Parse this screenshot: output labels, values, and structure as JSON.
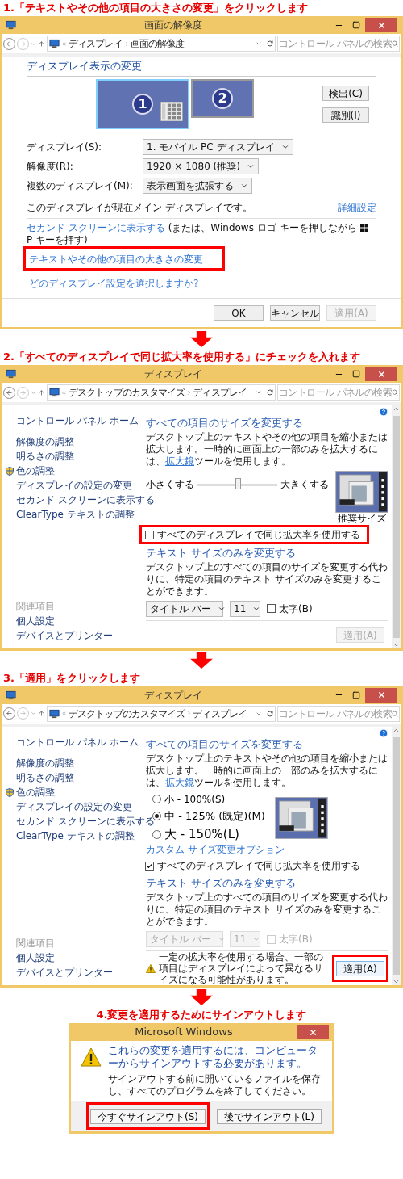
{
  "step1": {
    "heading": "1.「テキストやその他の項目の大きさの変更」をクリックします",
    "window": {
      "title": "画面の解像度",
      "breadcrumbs": [
        "ディスプレイ",
        "画面の解像度"
      ],
      "search": {
        "placeholder": "コントロール パネルの検索"
      },
      "section_title": "ディスプレイ表示の変更",
      "monitors": [
        {
          "label": "1",
          "selected": true
        },
        {
          "label": "2",
          "selected": false
        }
      ],
      "side_buttons": [
        "検出(C)",
        "識別(I)"
      ],
      "fields": [
        {
          "label": "ディスプレイ(S):",
          "value": "1. モバイル PC ディスプレイ"
        },
        {
          "label": "解像度(R):",
          "value": "1920 × 1080 (推奨)"
        },
        {
          "label": "複数のディスプレイ(M):",
          "value": "表示画面を拡張する"
        }
      ],
      "main_note": "このディスプレイが現在メイン ディスプレイです。",
      "advanced_link": "詳細設定",
      "second_screen": {
        "link": "セカンド スクリーンに表示する",
        "note_before": "(または、Windows ロゴ キーを押しながら",
        "note_after": "P キーを押す)"
      },
      "links": [
        {
          "text": "テキストやその他の項目の大きさの変更",
          "highlighted": true
        },
        {
          "text": "どのディスプレイ設定を選択しますか?",
          "highlighted": false
        }
      ],
      "buttons": [
        {
          "label": "OK",
          "disabled": false
        },
        {
          "label": "キャンセル",
          "disabled": false
        },
        {
          "label": "適用(A)",
          "disabled": true
        }
      ]
    }
  },
  "step2": {
    "heading": "2.「すべてのディスプレイで同じ拡大率を使用する」にチェックを入れます",
    "window": {
      "title": "ディスプレイ",
      "breadcrumbs": [
        "デスクトップのカスタマイズ",
        "ディスプレイ"
      ],
      "search": {
        "placeholder": "コントロール パネルの検索"
      },
      "sidebar": {
        "home": "コントロール パネル ホーム",
        "items": [
          {
            "text": "解像度の調整",
            "shield": false
          },
          {
            "text": "明るさの調整",
            "shield": false
          },
          {
            "text": "色の調整",
            "shield": true
          },
          {
            "text": "ディスプレイの設定の変更",
            "shield": false
          },
          {
            "text": "セカンド スクリーンに表示する",
            "shield": false
          },
          {
            "text": "ClearType テキストの調整",
            "shield": false
          }
        ],
        "related_heading": "関連項目",
        "related": [
          "個人設定",
          "デバイスとプリンター"
        ]
      },
      "section1": {
        "title": "すべての項目のサイズを変更する",
        "desc_before": "デスクトップ上のテキストやその他の項目を縮小または拡大します。一時的に画面上の一部のみを拡大するには、",
        "desc_link": "拡大鏡",
        "desc_after": "ツールを使用します。"
      },
      "slider": {
        "min_label": "小さくする",
        "max_label": "大きくする",
        "level": 0.5
      },
      "preview_caption": "推奨サイズ",
      "checkbox": {
        "label": "すべてのディスプレイで同じ拡大率を使用する",
        "checked": false,
        "highlighted": true
      },
      "section2": {
        "title": "テキスト サイズのみを変更する",
        "description": "デスクトップ上のすべての項目のサイズを変更する代わりに、特定の項目のテキスト サイズのみを変更することができます。",
        "item": "タイトル バー",
        "size": "11",
        "bold": {
          "label": "太字(B)",
          "checked": false
        },
        "disabled": false
      },
      "apply": {
        "label": "適用(A)",
        "disabled": true,
        "highlighted": false
      }
    }
  },
  "step3": {
    "heading": "3.「適用」をクリックします",
    "window": {
      "title": "ディスプレイ",
      "breadcrumbs": [
        "デスクトップのカスタマイズ",
        "ディスプレイ"
      ],
      "search": {
        "placeholder": "コントロール パネルの検索"
      },
      "sidebar": {
        "home": "コントロール パネル ホーム",
        "items": [
          {
            "text": "解像度の調整",
            "shield": false
          },
          {
            "text": "明るさの調整",
            "shield": false
          },
          {
            "text": "色の調整",
            "shield": true
          },
          {
            "text": "ディスプレイの設定の変更",
            "shield": false
          },
          {
            "text": "セカンド スクリーンに表示する",
            "shield": false
          },
          {
            "text": "ClearType テキストの調整",
            "shield": false
          }
        ],
        "related_heading": "関連項目",
        "related": [
          "個人設定",
          "デバイスとプリンター"
        ]
      },
      "section1": {
        "title": "すべての項目のサイズを変更する",
        "desc_before": "デスクトップ上のテキストやその他の項目を縮小または拡大します。一時的に画面上の一部のみを拡大するには、",
        "desc_link": "拡大鏡",
        "desc_after": "ツールを使用します。"
      },
      "radios": [
        {
          "label": "小 - 100%(S)",
          "kind": "small",
          "selected": false
        },
        {
          "label": "中 - 125% (既定)(M)",
          "kind": "medium",
          "selected": true
        },
        {
          "label": "大 - 150%(L)",
          "kind": "large",
          "selected": false
        }
      ],
      "custom_link": "カスタム サイズ変更オプション",
      "checkbox": {
        "label": "すべてのディスプレイで同じ拡大率を使用する",
        "checked": true,
        "highlighted": false
      },
      "section2": {
        "title": "テキスト サイズのみを変更する",
        "description": "デスクトップ上のすべての項目のサイズを変更する代わりに、特定の項目のテキスト サイズのみを変更することができます。",
        "item": "タイトル バー",
        "size": "11",
        "bold": {
          "label": "太字(B)",
          "checked": false
        },
        "disabled": true
      },
      "warning": "一定の拡大率を使用する場合、一部の項目はディスプレイによって異なるサイズになる可能性があります。",
      "apply": {
        "label": "適用(A)",
        "disabled": false,
        "highlighted": true
      }
    }
  },
  "step4": {
    "heading": "4.変更を適用するためにサインアウトします",
    "dialog": {
      "title": "Microsoft Windows",
      "instruction": "これらの変更を適用するには、コンピューターからサインアウトする必要があります。",
      "content": "サインアウトする前に開いているファイルを保存し、すべてのプログラムを終了してください。",
      "buttons": [
        {
          "label": "今すぐサインアウト(S)",
          "highlighted": true
        },
        {
          "label": "後でサインアウト(L)",
          "highlighted": false
        }
      ]
    }
  }
}
